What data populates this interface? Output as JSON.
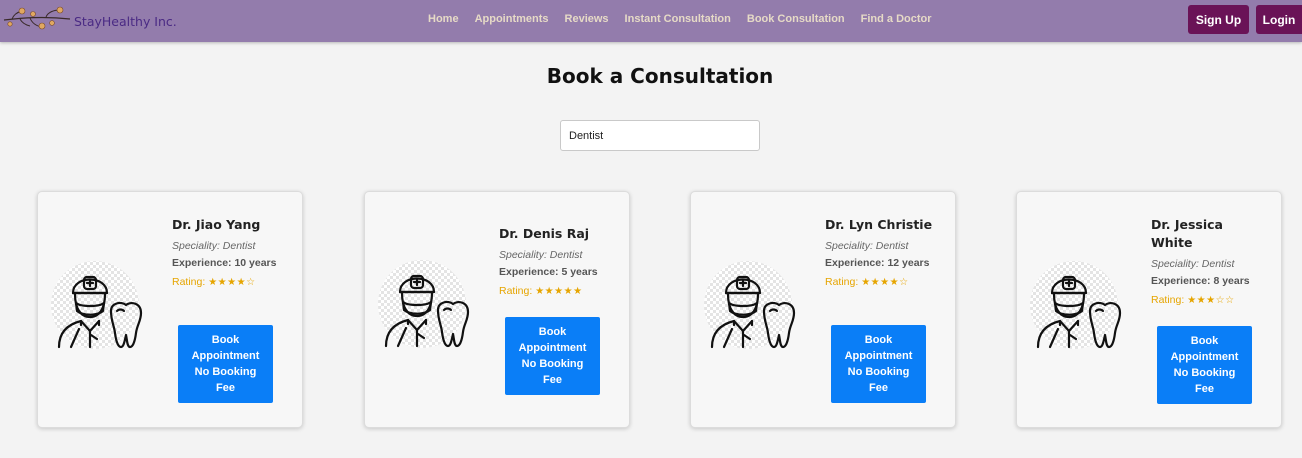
{
  "navbar": {
    "brand": "StayHealthy Inc.",
    "links": [
      "Home",
      "Appointments",
      "Reviews",
      "Instant Consultation",
      "Book Consultation",
      "Find a Doctor"
    ],
    "signup_label": "Sign Up",
    "login_label": "Login",
    "bg_color": "#937cac",
    "button_color": "#6a1357"
  },
  "page": {
    "title": "Book a Consultation"
  },
  "search": {
    "value": "Dentist"
  },
  "doctors": [
    {
      "name": "Dr. Jiao Yang",
      "speciality": "Speciality: Dentist",
      "experience": "Experience: 10 years",
      "rating_label": "Rating:",
      "stars": "★★★★☆",
      "rating": 4,
      "book_label": "Book Appointment No Booking Fee"
    },
    {
      "name": "Dr. Denis Raj",
      "speciality": "Speciality: Dentist",
      "experience": "Experience: 5 years",
      "rating_label": "Rating:",
      "stars": "★★★★★",
      "rating": 5,
      "book_label": "Book Appointment No Booking Fee"
    },
    {
      "name": "Dr. Lyn Christie",
      "speciality": "Speciality: Dentist",
      "experience": "Experience: 12 years",
      "rating_label": "Rating:",
      "stars": "★★★★☆",
      "rating": 4,
      "book_label": "Book Appointment No Booking Fee"
    },
    {
      "name": "Dr. Jessica White",
      "speciality": "Speciality: Dentist",
      "experience": "Experience: 8 years",
      "rating_label": "Rating:",
      "stars": "★★★☆☆",
      "rating": 3,
      "book_label": "Book Appointment No Booking Fee"
    }
  ],
  "colors": {
    "accent": "#0a7ef7",
    "star": "#e6a500"
  },
  "icons": {
    "logo": "flower-branch-logo",
    "avatar": "dentist-doctor-icon"
  }
}
